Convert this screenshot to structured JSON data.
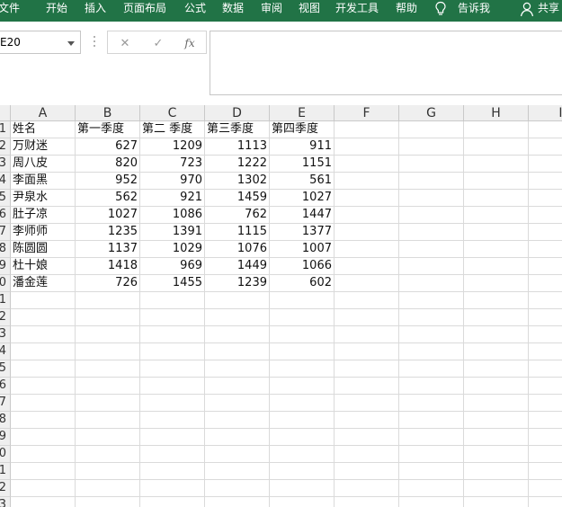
{
  "ribbon": {
    "tabs": [
      "文件",
      "开始",
      "插入",
      "页面布局",
      "公式",
      "数据",
      "审阅",
      "视图",
      "开发工具",
      "帮助"
    ],
    "tell_me": "告诉我",
    "share": "共享",
    "icons": [
      "lightbulb-icon",
      "person-icon"
    ],
    "color": "#217346"
  },
  "formula_bar": {
    "name_box": "E20",
    "cancel_glyph": "✕",
    "enter_glyph": "✓",
    "fx_glyph": "fx",
    "formula": ""
  },
  "sheet": {
    "columns": [
      "A",
      "B",
      "C",
      "D",
      "E",
      "F",
      "G",
      "H",
      "I"
    ],
    "row_numbers": [
      "1",
      "2",
      "3",
      "4",
      "5",
      "6",
      "7",
      "8",
      "9",
      "10",
      "11",
      "12",
      "13",
      "14",
      "15",
      "16",
      "17",
      "18",
      "19",
      "20",
      "21",
      "22",
      "23"
    ],
    "header": [
      "姓名",
      "第一季度",
      "第二 季度",
      "第三季度",
      "第四季度"
    ],
    "rows": [
      [
        "万财迷",
        "627",
        "1209",
        "1113",
        "911"
      ],
      [
        "周八皮",
        "820",
        "723",
        "1222",
        "1151"
      ],
      [
        "李面黑",
        "952",
        "970",
        "1302",
        "561"
      ],
      [
        "尹泉水",
        "562",
        "921",
        "1459",
        "1027"
      ],
      [
        "肚子凉",
        "1027",
        "1086",
        "762",
        "1447"
      ],
      [
        "李师师",
        "1235",
        "1391",
        "1115",
        "1377"
      ],
      [
        "陈圆圆",
        "1137",
        "1029",
        "1076",
        "1007"
      ],
      [
        "杜十娘",
        "1418",
        "969",
        "1449",
        "1066"
      ],
      [
        "潘金莲",
        "726",
        "1455",
        "1239",
        "602"
      ]
    ]
  }
}
